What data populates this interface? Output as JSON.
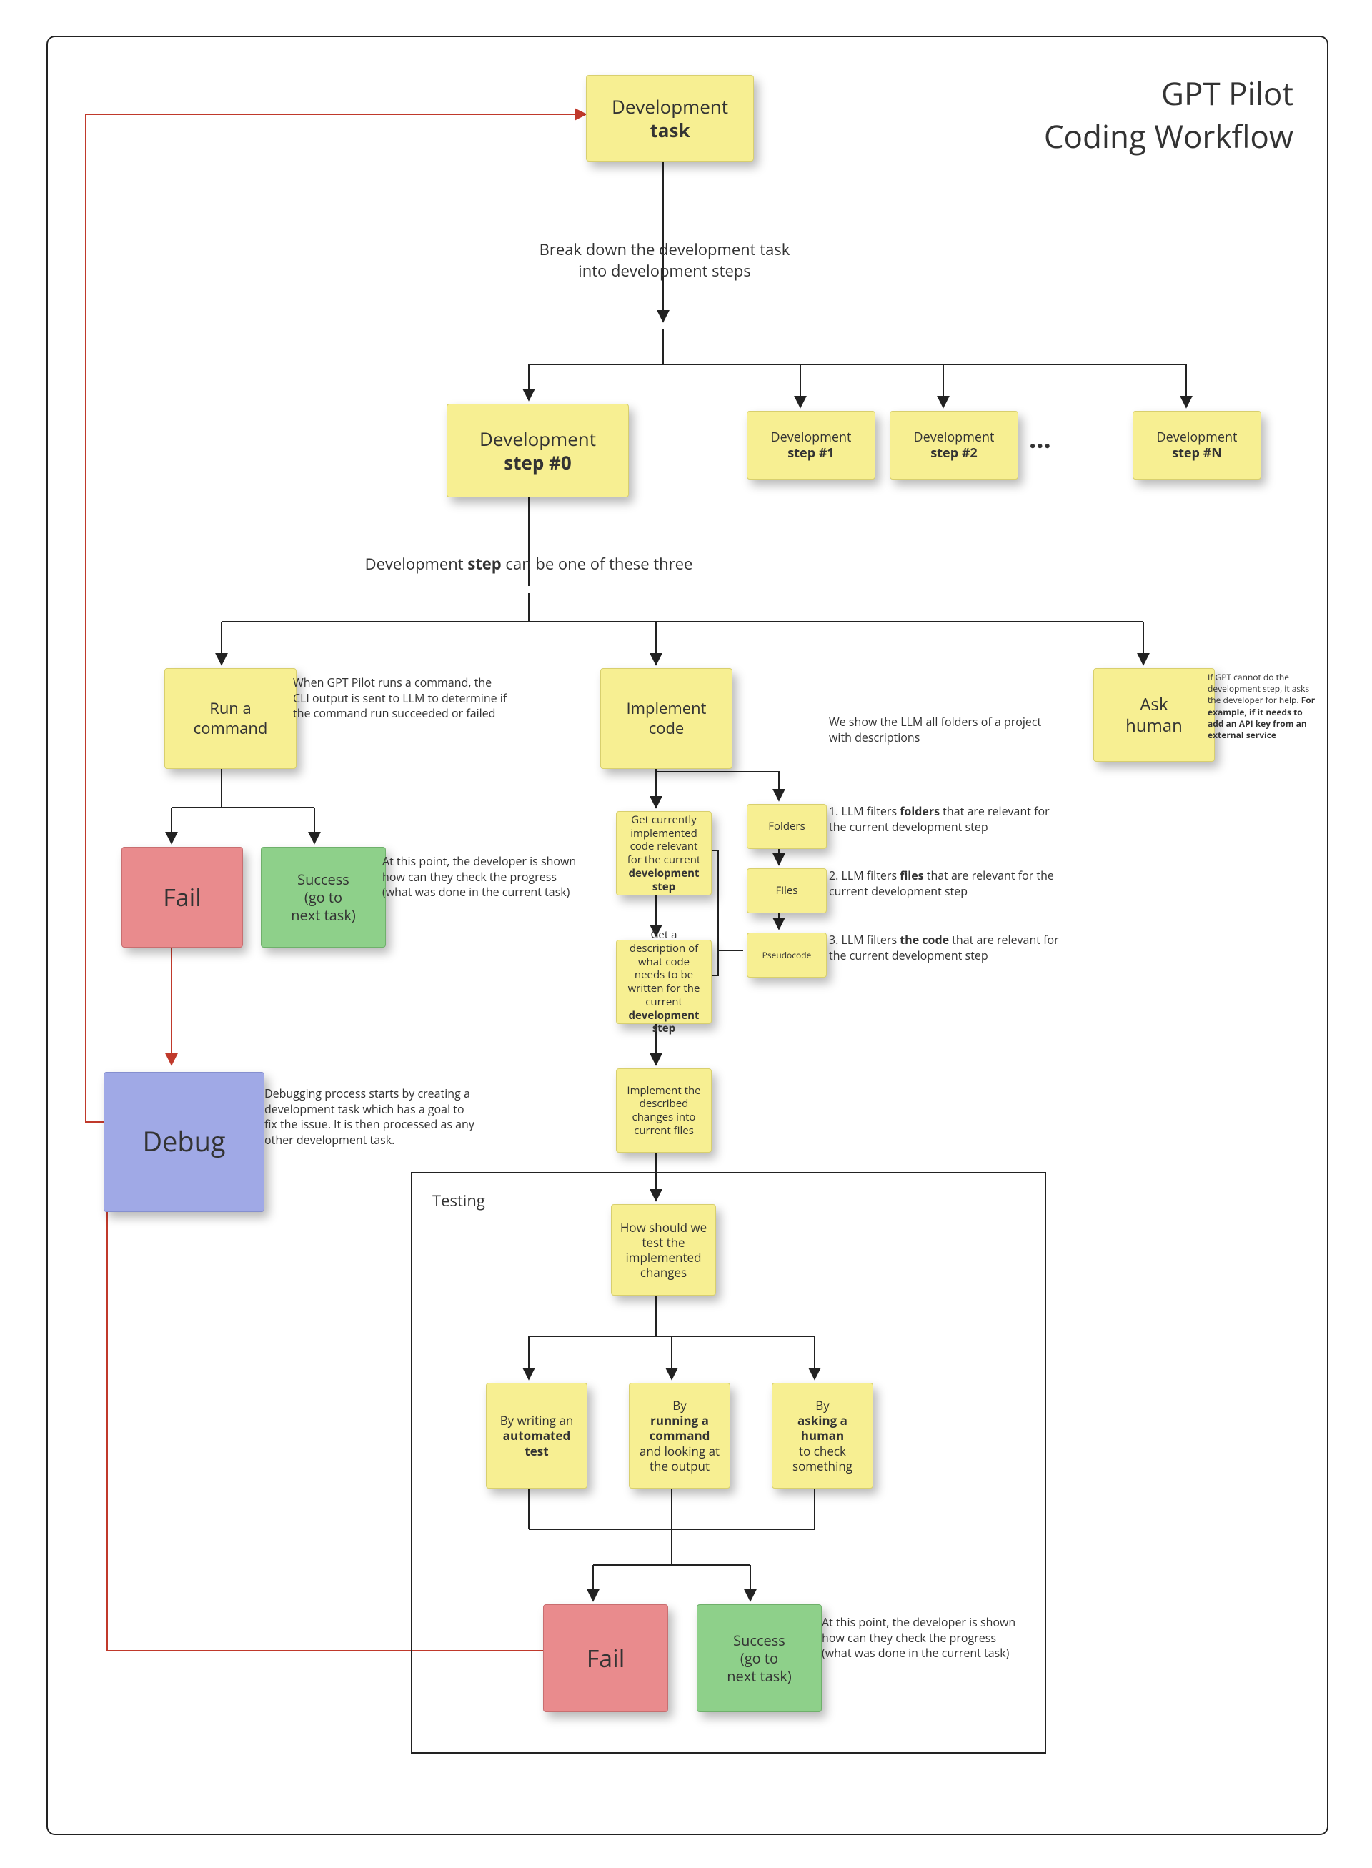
{
  "title": {
    "line1": "GPT Pilot",
    "line2": "Coding Workflow"
  },
  "dev_task": {
    "l1": "Development",
    "l2": "task"
  },
  "breakdown_caption": {
    "l1": "Break down the development task",
    "l2": "into development steps"
  },
  "step0": {
    "l1": "Development",
    "l2": "step #0"
  },
  "step1": {
    "l1": "Development",
    "l2": "step #1"
  },
  "step2": {
    "l1": "Development",
    "l2": "step #2"
  },
  "ellipsis": "…",
  "stepN": {
    "l1": "Development",
    "l2": "step #N"
  },
  "branch_caption": {
    "pre": "Development ",
    "b": "step",
    "post": " can be one of these three"
  },
  "run_cmd": {
    "l1": "Run a",
    "l2": "command"
  },
  "run_cmd_note": "When GPT Pilot runs a command, the CLI output is sent to LLM to determine if the command run succeeded or failed",
  "implement_code": {
    "l1": "Implement",
    "l2": "code"
  },
  "ask_human": {
    "l1": "Ask",
    "l2": "human"
  },
  "ask_human_note": {
    "p": "If GPT cannot do the development step, it asks the developer for help.",
    "b": "For example, if it needs to add an API key from an external service"
  },
  "fail": "Fail",
  "success": {
    "l1": "Success",
    "l2": "(go to",
    "l3": "next task)"
  },
  "success_note": "At this point, the developer is shown how can they check the progress (what was done in the current task)",
  "debug": "Debug",
  "debug_note": "Debugging process starts by creating a development task which has a goal to fix the issue. It is then processed as any other development task.",
  "impl": {
    "folders_intro": "We show the LLM all folders of a project with descriptions",
    "get_code": {
      "pre": "Get currently implemented code relevant for the current",
      "b": "development step"
    },
    "get_desc": {
      "pre": "Get a description of what code needs to be written for the current",
      "b": "development step"
    },
    "apply": "Implement the described changes into current files",
    "folders": "Folders",
    "files": "Files",
    "pseudocode": "Pseudocode",
    "f1": {
      "pre": "1. LLM filters ",
      "b": "folders",
      "post": " that are relevant for the current  development step"
    },
    "f2": {
      "pre": "2. LLM filters ",
      "b": "files",
      "post": " that are relevant for the current  development step"
    },
    "f3": {
      "pre": "3. LLM filters ",
      "b": "the code",
      "post": " that are relevant for the current  development step"
    }
  },
  "testing": {
    "label": "Testing",
    "q": "How should we test the implemented changes",
    "opt_auto": {
      "pre": "By writing an",
      "b": "automated test"
    },
    "opt_cmd": {
      "pre1": "By ",
      "b": "running a command",
      "post": " and looking at the output"
    },
    "opt_human": {
      "pre1": "By ",
      "b": "asking a human",
      "post": " to check something"
    },
    "fail": "Fail",
    "success": {
      "l1": "Success",
      "l2": "(go to",
      "l3": "next task)"
    },
    "success_note": "At this point, the developer is shown how can they check the progress (what was done in the current task)"
  }
}
